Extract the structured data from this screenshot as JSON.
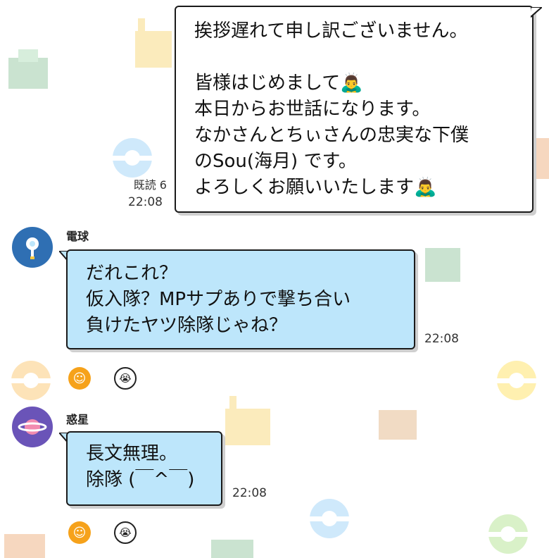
{
  "messages": [
    {
      "side": "me",
      "text": "挨拶遅れて申し訳ございません。\n\n皆様はじめまして🙇‍♂️\n本日からお世話になります。\nなかさんとちぃさんの忠実な下僕\nのSou(海月) です。\nよろしくお願いいたします🙇‍♂️",
      "read": "既読 6",
      "time": "22:08"
    },
    {
      "side": "them",
      "sender": "電球",
      "text": "だれこれ？\n仮入隊？MPサプありで撃ち合い\n負けたヤツ除隊じゃね？",
      "time": "22:08",
      "reactions": [
        "smile-icon",
        "crying-face-icon"
      ]
    },
    {
      "side": "them",
      "sender": "惑星",
      "text": "長文無理。\n除隊 (￣^￣)",
      "time": "22:08",
      "reactions": [
        "smile-icon",
        "crying-face-icon"
      ]
    }
  ],
  "colors": {
    "incoming_bubble": "#bde6fb",
    "outgoing_bubble": "#ffffff",
    "avatar_bulb": "#2f6fb3",
    "avatar_planet": "#6a54b8",
    "reaction_smile": "#f6a21b"
  }
}
